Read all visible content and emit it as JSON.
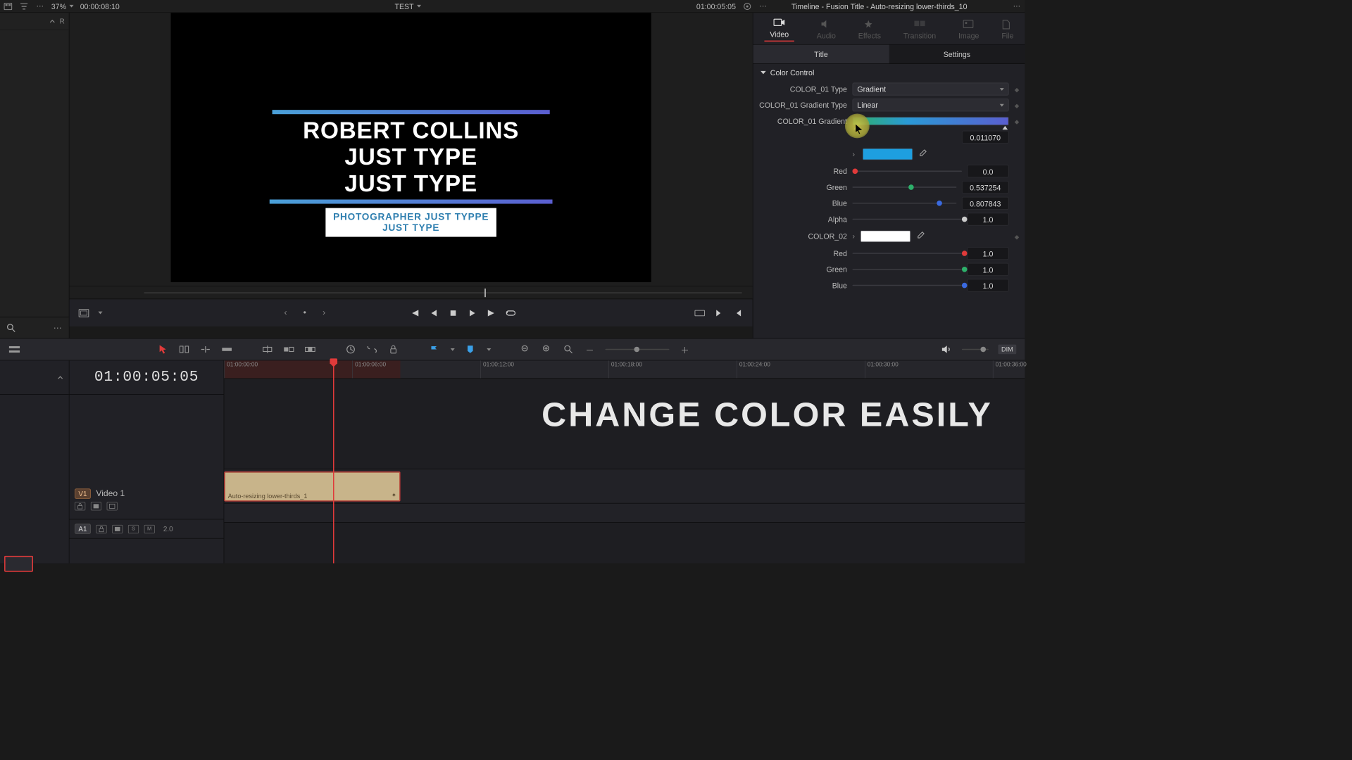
{
  "topbar": {
    "zoom_pct": "37%",
    "pool_tc": "00:00:08:10",
    "project_name": "TEST",
    "viewer_tc": "01:00:05:05",
    "inspector_title": "Timeline - Fusion Title - Auto-resizing lower-thirds_10"
  },
  "browser": {
    "item_prefix": "R"
  },
  "viewer": {
    "title_line1": "ROBERT COLLINS JUST TYPE",
    "title_line2": "JUST TYPE",
    "sub_line1": "PHOTOGRAPHER JUST TYPPE",
    "sub_line2": "JUST TYPE"
  },
  "inspector": {
    "tabs": {
      "video": "Video",
      "audio": "Audio",
      "effects": "Effects",
      "transition": "Transition",
      "image": "Image",
      "file": "File"
    },
    "subtabs": {
      "title": "Title",
      "settings": "Settings"
    },
    "section": "Color Control",
    "params": {
      "color01_type_label": "COLOR_01 Type",
      "color01_type_value": "Gradient",
      "color01_gradtype_label": "COLOR_01 Gradient Type",
      "color01_gradtype_value": "Linear",
      "color01_gradient_label": "COLOR_01 Gradient",
      "gradient_pos_value": "0.011070",
      "red_label": "Red",
      "red_value": "0.0",
      "green_label": "Green",
      "green_value": "0.537254",
      "blue_label": "Blue",
      "blue_value": "0.807843",
      "alpha_label": "Alpha",
      "alpha_value": "1.0",
      "color02_label": "COLOR_02",
      "red2_value": "1.0",
      "green2_value": "1.0",
      "blue2_value": "1.0"
    },
    "colors": {
      "swatch1": "#1e9fe0",
      "swatch2": "#ffffff",
      "red_dot": "#e03a3a",
      "green_dot": "#2db06a",
      "blue_dot": "#3a6ae0"
    }
  },
  "timeline": {
    "current_tc": "01:00:05:05",
    "ruler": [
      "01:00:00:00",
      "01:00:06:00",
      "01:00:12:00",
      "01:00:18:00",
      "01:00:24:00",
      "01:00:30:00",
      "01:00:36:00"
    ],
    "v1_badge": "V1",
    "v1_name": "Video 1",
    "a1_badge": "A1",
    "a1_s": "S",
    "a1_m": "M",
    "a1_ch": "2.0",
    "clip_name": "Auto-resizing lower-thirds_1",
    "overlay_text": "CHANGE COLOR EASILY"
  },
  "midbar": {
    "dim": "DIM"
  }
}
